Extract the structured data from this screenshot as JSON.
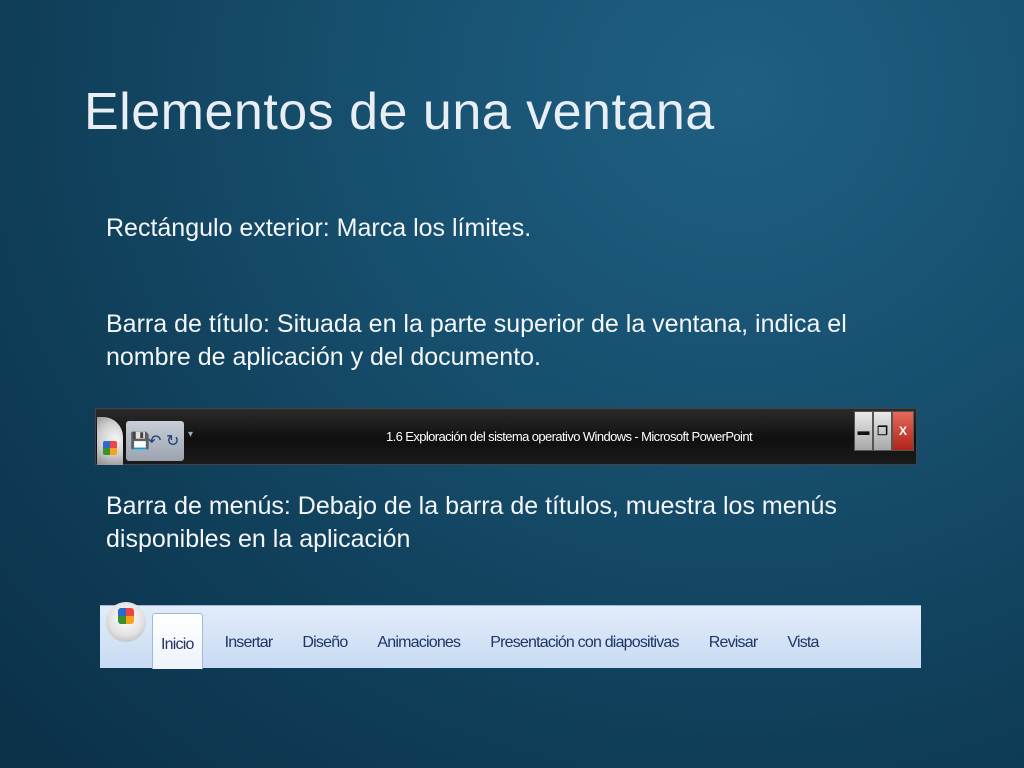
{
  "slide": {
    "title": "Elementos de una ventana",
    "paragraph1": "Rectángulo exterior: Marca los límites.",
    "paragraph2": "Barra de título: Situada en la parte superior de la ventana, indica el nombre de aplicación y del documento.",
    "paragraph3": "Barra de menús: Debajo de la barra de títulos, muestra los menús disponibles en la aplicación"
  },
  "titlebar": {
    "window_title": "1.6 Exploración del sistema operativo Windows - Microsoft PowerPoint",
    "qat_icons": [
      "save-icon",
      "undo-icon",
      "redo-icon"
    ],
    "buttons": {
      "minimize": "▬",
      "restore": "❐",
      "close": "X"
    }
  },
  "menubar": {
    "tabs": [
      {
        "label": "Inicio",
        "active": true
      },
      {
        "label": "Insertar"
      },
      {
        "label": "Diseño"
      },
      {
        "label": "Animaciones"
      },
      {
        "label": "Presentación con diapositivas"
      },
      {
        "label": "Revisar"
      },
      {
        "label": "Vista"
      }
    ]
  }
}
